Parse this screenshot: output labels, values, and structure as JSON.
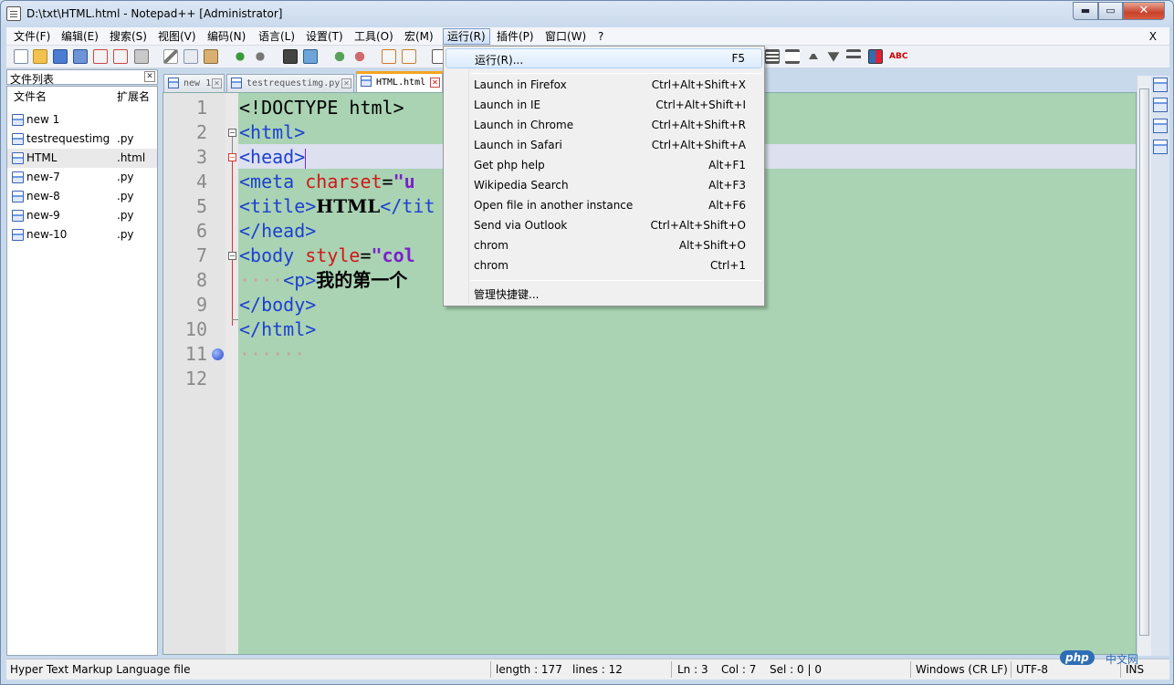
{
  "window": {
    "title": "D:\\txt\\HTML.html - Notepad++ [Administrator]",
    "min_label": "▬",
    "max_label": "▭",
    "close_label": "✕"
  },
  "menubar": {
    "items": [
      "文件(F)",
      "编辑(E)",
      "搜索(S)",
      "视图(V)",
      "编码(N)",
      "语言(L)",
      "设置(T)",
      "工具(O)",
      "宏(M)",
      "运行(R)",
      "插件(P)",
      "窗口(W)",
      "?"
    ],
    "close_label": "X"
  },
  "panel": {
    "title": "文件列表",
    "close_label": "✕",
    "col_name": "文件名",
    "col_ext": "扩展名",
    "files": [
      {
        "name": "new 1",
        "ext": ""
      },
      {
        "name": "testrequestimg",
        "ext": ".py"
      },
      {
        "name": "HTML",
        "ext": ".html"
      },
      {
        "name": "new-7",
        "ext": ".py"
      },
      {
        "name": "new-8",
        "ext": ".py"
      },
      {
        "name": "new-9",
        "ext": ".py"
      },
      {
        "name": "new-10",
        "ext": ".py"
      }
    ]
  },
  "tabs": [
    {
      "label": "new 1"
    },
    {
      "label": "testrequestimg.py"
    },
    {
      "label": "HTML.html"
    }
  ],
  "tab_close": "✕",
  "editor": {
    "line_numbers": [
      "1",
      "2",
      "3",
      "4",
      "5",
      "6",
      "7",
      "8",
      "9",
      "10",
      "11",
      "12"
    ],
    "code": {
      "l1": "<!DOCTYPE html>",
      "l2": "<html>",
      "l3": "<head>",
      "l4_tag": "<meta ",
      "l4_attr": "charset",
      "l4_eq": "=",
      "l4_val": "\"u",
      "l5_tag_open": "<title>",
      "l5_text": "HTML",
      "l5_tag_close": "</tit",
      "l6": "</head>",
      "l7_tag": "<body ",
      "l7_attr": "style",
      "l7_eq": "=",
      "l7_val": "\"col",
      "l8_indent": "····",
      "l8_tag": "<p>",
      "l8_text": "我的第一个",
      "l9": "</body>",
      "l10": "</html>",
      "l11_indent": "······"
    },
    "fold_open": "−"
  },
  "run_menu": {
    "items": [
      {
        "label": "运行(R)...",
        "shortcut": "F5"
      },
      {
        "label": "Launch in Firefox",
        "shortcut": "Ctrl+Alt+Shift+X"
      },
      {
        "label": "Launch in IE",
        "shortcut": "Ctrl+Alt+Shift+I"
      },
      {
        "label": "Launch in Chrome",
        "shortcut": "Ctrl+Alt+Shift+R"
      },
      {
        "label": "Launch in Safari",
        "shortcut": "Ctrl+Alt+Shift+A"
      },
      {
        "label": "Get php help",
        "shortcut": "Alt+F1"
      },
      {
        "label": "Wikipedia Search",
        "shortcut": "Alt+F3"
      },
      {
        "label": "Open file in another instance",
        "shortcut": "Alt+F6"
      },
      {
        "label": "Send via Outlook",
        "shortcut": "Ctrl+Alt+Shift+O"
      },
      {
        "label": "chrom",
        "shortcut": "Alt+Shift+O"
      },
      {
        "label": "chrom",
        "shortcut": "Ctrl+1"
      },
      {
        "label": "管理快捷键...",
        "shortcut": ""
      }
    ]
  },
  "status": {
    "file_type": "Hyper Text Markup Language file",
    "length": "length : 177",
    "lines": "lines : 12",
    "ln": "Ln : 3",
    "col": "Col : 7",
    "sel": "Sel : 0 | 0",
    "eol": "Windows (CR LF)",
    "encoding": "UTF-8",
    "mode": "INS"
  },
  "watermark": {
    "logo": "php",
    "text": "中文网"
  },
  "tab_scroll_arrow": "◀"
}
